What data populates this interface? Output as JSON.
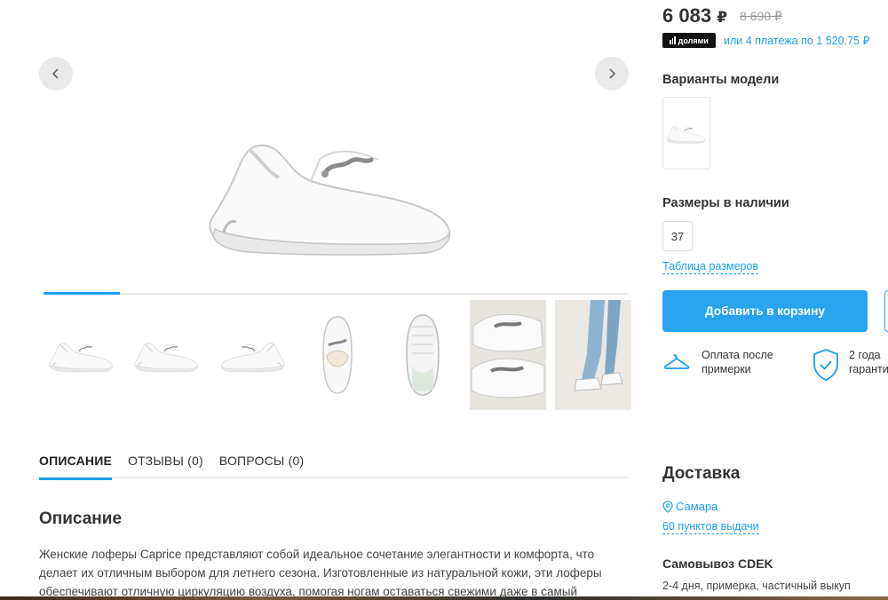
{
  "gallery": {
    "prev_icon": "chevron-left-icon",
    "next_icon": "chevron-right-icon",
    "progress": 0.13,
    "thumbnails": [
      "shoe-side",
      "shoe-angle",
      "shoe-side-right",
      "shoe-top",
      "shoe-sole",
      "shoe-closeup-photo",
      "shoe-on-feet-photo"
    ]
  },
  "tabs": [
    {
      "label": "ОПИСАНИЕ",
      "active": true
    },
    {
      "label": "ОТЗЫВЫ (0)",
      "active": false
    },
    {
      "label": "ВОПРОСЫ (0)",
      "active": false
    }
  ],
  "description": {
    "title": "Описание",
    "text": "Женские лоферы Caprice представляют собой идеальное сочетание элегантности и комфорта, что делает их отличным выбором для летнего сезона. Изготовленные из натуральной кожи, эти лоферы обеспечивают отличную циркуляцию воздуха, помогая ногам оставаться свежими даже в самый"
  },
  "pricing": {
    "price": "6 083",
    "currency": "₽",
    "old_price": "8 690 ₽",
    "dolyami_label": "долями",
    "installments": "или 4 платежа по 1 520.75 ₽"
  },
  "variants": {
    "title": "Варианты модели"
  },
  "sizes": {
    "title": "Размеры в наличии",
    "items": [
      "37"
    ],
    "table_link": "Таблица размеров"
  },
  "cart": {
    "add_label": "Добавить в корзину"
  },
  "features": [
    {
      "icon": "hanger-icon",
      "line1": "Оплата после",
      "line2": "примерки"
    },
    {
      "icon": "shield-check-icon",
      "line1": "2 года",
      "line2": "гаранти"
    }
  ],
  "delivery": {
    "title": "Доставка",
    "city": "Самара",
    "pickup_points": "60 пунктов выдачи",
    "cdek_title": "Самовывоз CDEK",
    "cdek_info": "2-4 дня, примерка, частичный выкуп"
  },
  "colors": {
    "accent": "#1a9ff0",
    "button": "#27a3f0"
  }
}
